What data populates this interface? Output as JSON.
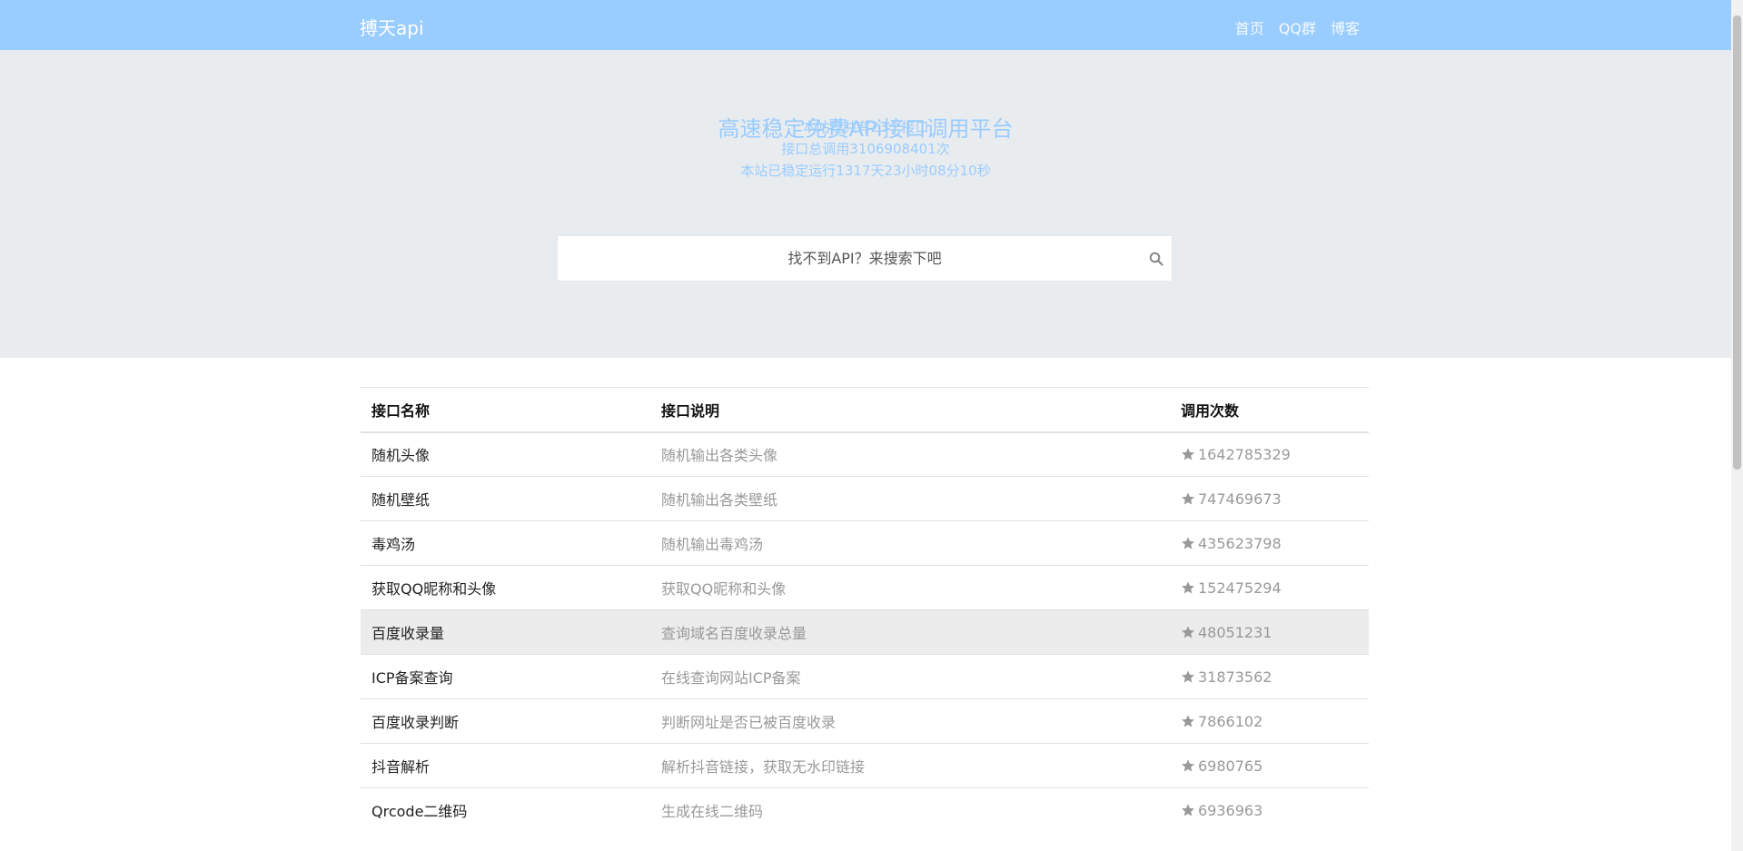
{
  "navbar": {
    "brand": "搏天api",
    "links": [
      "首页",
      "QQ群",
      "博客"
    ]
  },
  "hero": {
    "title": "高速稳定免费APi接口调用平台",
    "stat_count": "本站现共有23个接口",
    "stat_calls": "接口总调用3106908401次",
    "stat_uptime": "本站已稳定运行1317天23小时08分10秒"
  },
  "search": {
    "placeholder": "找不到API？来搜索下吧",
    "icon": "search-icon"
  },
  "table": {
    "headers": [
      "接口名称",
      "接口说明",
      "调用次数"
    ],
    "rows": [
      {
        "name": "随机头像",
        "desc": "随机输出各类头像",
        "count": "1642785329"
      },
      {
        "name": "随机壁纸",
        "desc": "随机输出各类壁纸",
        "count": "747469673"
      },
      {
        "name": "毒鸡汤",
        "desc": "随机输出毒鸡汤",
        "count": "435623798"
      },
      {
        "name": "获取QQ昵称和头像",
        "desc": "获取QQ昵称和头像",
        "count": "152475294"
      },
      {
        "name": "百度收录量",
        "desc": "查询域名百度收录总量",
        "count": "48051231"
      },
      {
        "name": "ICP备案查询",
        "desc": "在线查询网站ICP备案",
        "count": "31873562"
      },
      {
        "name": "百度收录判断",
        "desc": "判断网址是否已被百度收录",
        "count": "7866102"
      },
      {
        "name": "抖音解析",
        "desc": "解析抖音链接，获取无水印链接",
        "count": "6980765"
      },
      {
        "name": "Qrcode二维码",
        "desc": "生成在线二维码",
        "count": "6936963"
      }
    ],
    "highlighted_row": 4,
    "count_icon": "star-icon"
  },
  "colors": {
    "navbar": "#99ccff",
    "hero_bg": "#e9ecef",
    "hero_text": "#99ccff"
  }
}
